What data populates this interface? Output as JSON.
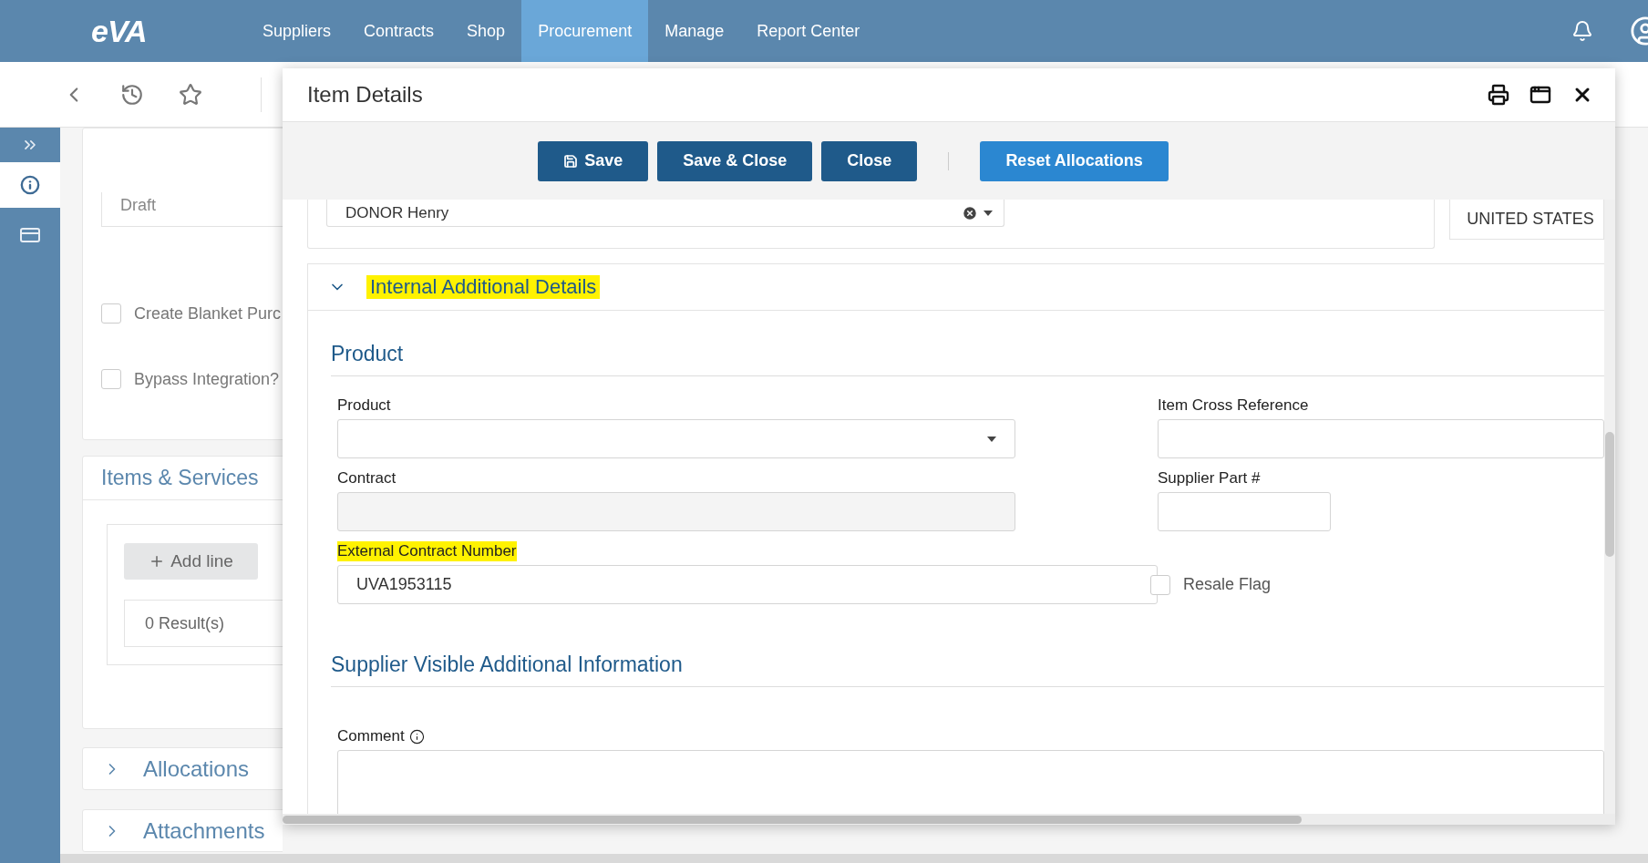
{
  "nav": {
    "logo": "eVA",
    "items": [
      {
        "label": "Suppliers",
        "selected": false
      },
      {
        "label": "Contracts",
        "selected": false
      },
      {
        "label": "Shop",
        "selected": false
      },
      {
        "label": "Procurement",
        "selected": true
      },
      {
        "label": "Manage",
        "selected": false
      },
      {
        "label": "Report Center",
        "selected": false
      }
    ]
  },
  "sidebar": {
    "items": [
      {
        "kind": "expand",
        "selected": false
      },
      {
        "kind": "info",
        "selected": true
      },
      {
        "kind": "card",
        "selected": false
      }
    ]
  },
  "background": {
    "status_field": "Draft",
    "checkboxes": [
      {
        "label": "Create Blanket Purc",
        "checked": false
      },
      {
        "label": "Bypass Integration?",
        "checked": false
      }
    ],
    "items_section": {
      "title": "Items & Services",
      "add_button": "Add line",
      "results": "0 Result(s)"
    },
    "collapsed_sections": [
      {
        "title": "Allocations",
        "expanded": false
      },
      {
        "title": "Attachments",
        "expanded": false
      }
    ]
  },
  "modal": {
    "title": "Item Details",
    "buttons": [
      {
        "label": "Save",
        "kind": "dark",
        "has_icon": true
      },
      {
        "label": "Save & Close",
        "kind": "dark",
        "has_icon": false
      },
      {
        "label": "Close",
        "kind": "dark",
        "has_icon": false
      },
      {
        "label": "Reset Allocations",
        "kind": "light",
        "has_icon": false
      }
    ],
    "donor_field": "DONOR Henry",
    "country": "UNITED STATES",
    "section": {
      "title": "Internal Additional Details",
      "expanded": true,
      "highlighted": true
    },
    "groups": [
      {
        "heading": "Product",
        "rows": [
          {
            "left": {
              "label": "Product",
              "kind": "select",
              "highlighted": false
            },
            "right": {
              "label": "Item Cross Reference",
              "kind": "text",
              "highlighted": false
            }
          },
          {
            "left": {
              "label": "Contract",
              "kind": "disabled",
              "highlighted": false
            },
            "right": {
              "label": "Supplier Part #",
              "kind": "short_text",
              "highlighted": false
            }
          },
          {
            "left": {
              "label": "External Contract Number",
              "kind": "text",
              "highlighted": true,
              "value": "UVA1953115"
            },
            "right": {
              "label": "Resale Flag",
              "kind": "checkbox",
              "checked": false
            }
          }
        ]
      },
      {
        "heading": "Supplier Visible Additional Information",
        "rows": [
          {
            "left": {
              "label": "Comment",
              "kind": "textarea",
              "highlighted": false,
              "info": true
            }
          }
        ]
      }
    ]
  }
}
